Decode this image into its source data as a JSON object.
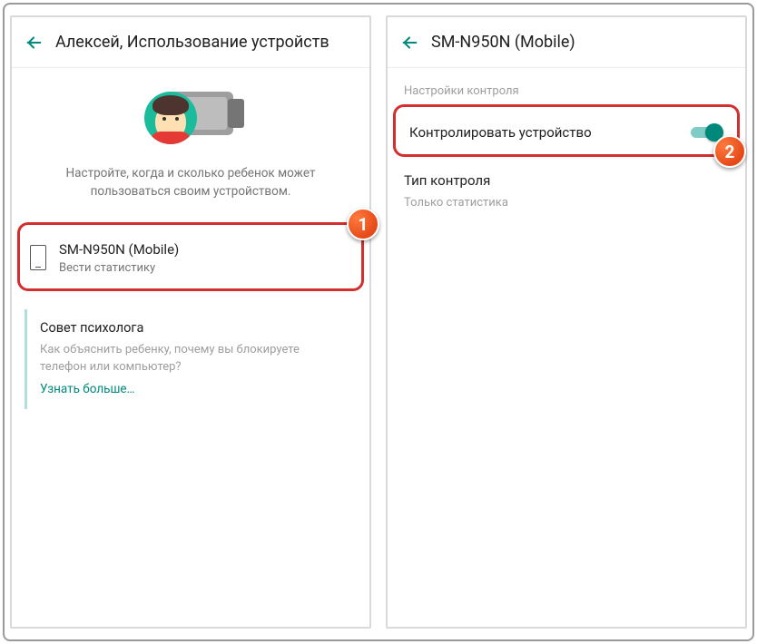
{
  "left": {
    "header_title": "Алексей, Использование устройств",
    "hero_text": "Настройте, когда и сколько ребенок может пользоваться своим устройством.",
    "device_name": "SM-N950N (Mobile)",
    "device_sub": "Вести статистику",
    "tip_title": "Совет психолога",
    "tip_body": "Как объяснить ребенку, почему вы блокируете телефон или компьютер?",
    "tip_link": "Узнать больше…"
  },
  "right": {
    "header_title": "SM-N950N (Mobile)",
    "section_label": "Настройки контроля",
    "toggle_label": "Контролировать устройство",
    "ctrl_type_title": "Тип контроля",
    "ctrl_type_value": "Только статистика"
  },
  "badges": {
    "one": "1",
    "two": "2"
  }
}
